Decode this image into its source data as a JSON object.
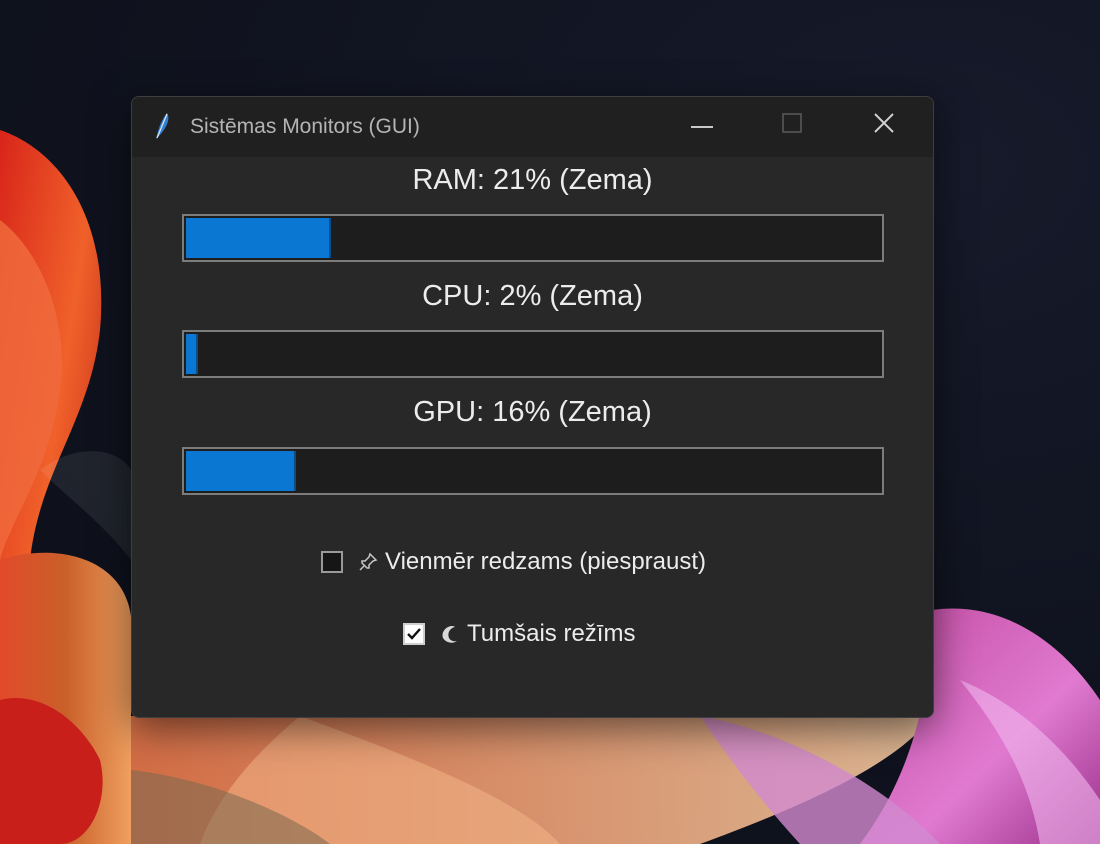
{
  "window": {
    "title": "Sistēmas Monitors (GUI)",
    "icon": "feather-icon",
    "controls": [
      "minimize-icon",
      "maximize-icon",
      "close-icon"
    ]
  },
  "metrics": [
    {
      "id": "ram",
      "label": "RAM: 21% (Zema)",
      "percent": 21
    },
    {
      "id": "cpu",
      "label": "CPU: 2% (Zema)",
      "percent": 2
    },
    {
      "id": "gpu",
      "label": "GPU: 16% (Zema)",
      "percent": 16
    }
  ],
  "options": {
    "always_on_top": {
      "label": "Vienmēr redzams (piespraust)",
      "checked": false,
      "icon": "pushpin-icon"
    },
    "dark_mode": {
      "label": "Tumšais režīms",
      "checked": true,
      "icon": "crescent-moon-icon"
    }
  },
  "colors": {
    "accent": "#0a78d2",
    "window_bg": "#282828",
    "titlebar_bg": "#202020"
  }
}
